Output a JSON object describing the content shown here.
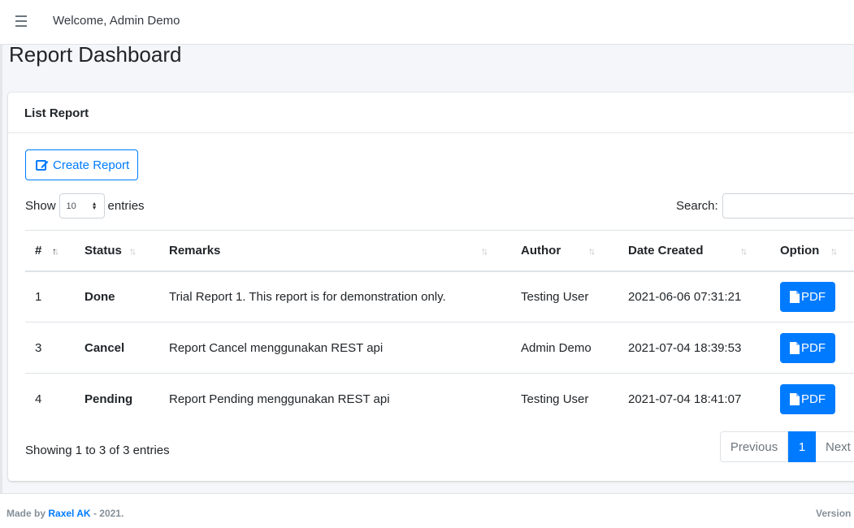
{
  "navbar": {
    "welcome": "Welcome, Admin Demo"
  },
  "page": {
    "title": "Report Dashboard"
  },
  "card": {
    "title": "List Report",
    "create_button": "Create Report",
    "show_label": "Show",
    "page_size": "10",
    "entries_label": "entries",
    "search_label": "Search:",
    "search_value": ""
  },
  "table": {
    "headers": [
      "#",
      "Status",
      "Remarks",
      "Author",
      "Date Created",
      "Option"
    ],
    "rows": [
      {
        "id": "1",
        "status": "Done",
        "remarks": "Trial Report 1. This report is for demonstration only.",
        "author": "Testing User",
        "date": "2021-06-06 07:31:21",
        "option": "PDF"
      },
      {
        "id": "3",
        "status": "Cancel",
        "remarks": "Report Cancel menggunakan REST api",
        "author": "Admin Demo",
        "date": "2021-07-04 18:39:53",
        "option": "PDF"
      },
      {
        "id": "4",
        "status": "Pending",
        "remarks": "Report Pending menggunakan REST api",
        "author": "Testing User",
        "date": "2021-07-04 18:41:07",
        "option": "PDF"
      }
    ]
  },
  "info": "Showing 1 to 3 of 3 entries",
  "pagination": {
    "previous": "Previous",
    "current": "1",
    "next": "Next"
  },
  "footer": {
    "made_by": "Made by",
    "author": "Raxel AK",
    "year": "- 2021.",
    "version": "Version"
  },
  "colors": {
    "primary": "#007bff",
    "background": "#f4f6f9"
  },
  "icons": {
    "menu": "hamburger-icon",
    "create": "edit-icon",
    "pdf": "file-icon",
    "sort": "sort-icon"
  }
}
